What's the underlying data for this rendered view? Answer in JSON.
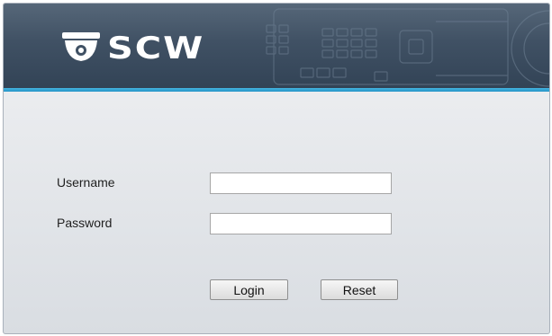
{
  "header": {
    "logo_text": "SCW",
    "logo_icon": "dome-camera-icon",
    "background_color": "#405164",
    "accent_color": "#2a9fd6"
  },
  "form": {
    "username_label": "Username",
    "password_label": "Password",
    "username_value": "",
    "password_value": ""
  },
  "buttons": {
    "login_label": "Login",
    "reset_label": "Reset"
  }
}
